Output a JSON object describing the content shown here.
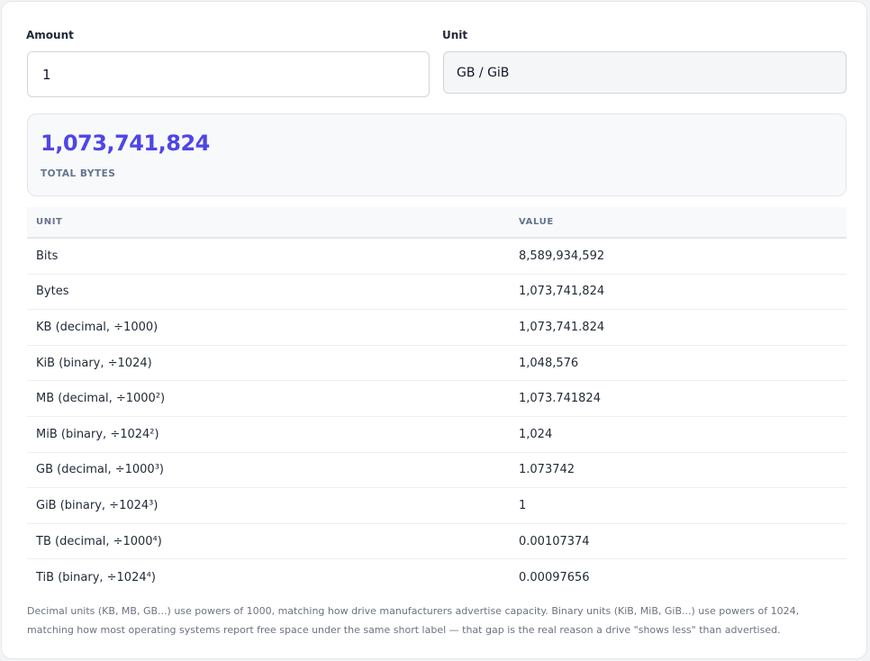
{
  "form": {
    "amount_label": "Amount",
    "amount_value": "1",
    "unit_label": "Unit",
    "unit_selected": "GB / GiB"
  },
  "result": {
    "total_bytes": "1,073,741,824",
    "caption": "TOTAL BYTES"
  },
  "table": {
    "headers": {
      "unit": "UNIT",
      "value": "VALUE"
    },
    "rows": [
      {
        "unit": "Bits",
        "value": "8,589,934,592"
      },
      {
        "unit": "Bytes",
        "value": "1,073,741,824"
      },
      {
        "unit": "KB (decimal, ÷1000)",
        "value": "1,073,741.824"
      },
      {
        "unit": "KiB (binary, ÷1024)",
        "value": "1,048,576"
      },
      {
        "unit": "MB (decimal, ÷1000²)",
        "value": "1,073.741824"
      },
      {
        "unit": "MiB (binary, ÷1024²)",
        "value": "1,024"
      },
      {
        "unit": "GB (decimal, ÷1000³)",
        "value": "1.073742"
      },
      {
        "unit": "GiB (binary, ÷1024³)",
        "value": "1"
      },
      {
        "unit": "TB (decimal, ÷1000⁴)",
        "value": "0.00107374"
      },
      {
        "unit": "TiB (binary, ÷1024⁴)",
        "value": "0.00097656"
      }
    ]
  },
  "footnote": "Decimal units (KB, MB, GB...) use powers of 1000, matching how drive manufacturers advertise capacity. Binary units (KiB, MiB, GiB...) use powers of 1024, matching how most operating systems report free space under the same short label — that gap is the real reason a drive \"shows less\" than advertised.",
  "colors": {
    "accent": "#4f46e5",
    "muted": "#64748b"
  }
}
